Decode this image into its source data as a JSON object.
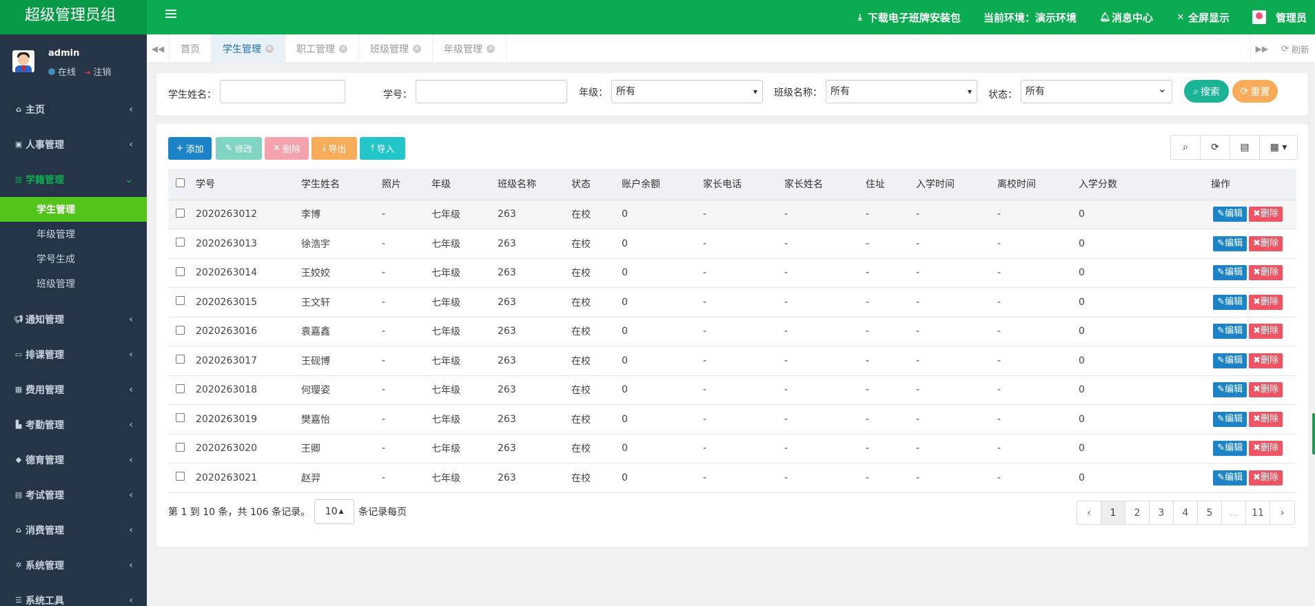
{
  "app": {
    "brand": "超级管理员组",
    "top_actions": [
      {
        "icon": "download-icon",
        "label": "下载电子班牌安装包"
      },
      {
        "icon": "env-icon",
        "label": "当前环境：演示环境"
      },
      {
        "icon": "bell-icon",
        "label": "消息中心"
      },
      {
        "icon": "fullscreen-icon",
        "label": "全屏显示"
      }
    ],
    "top_user": "管理员"
  },
  "sidebar": {
    "user": {
      "name": "admin",
      "status": "在线",
      "logout": "注销"
    },
    "menu": [
      {
        "icon": "home-icon",
        "label": "主页"
      },
      {
        "icon": "id-card-icon",
        "label": "人事管理"
      },
      {
        "icon": "bank-icon",
        "label": "学籍管理",
        "expanded": true,
        "children": [
          "学生管理",
          "年级管理",
          "学号生成",
          "班级管理"
        ]
      },
      {
        "icon": "bullhorn-icon",
        "label": "通知管理"
      },
      {
        "icon": "calendar-icon",
        "label": "排课管理"
      },
      {
        "icon": "calculator-icon",
        "label": "费用管理"
      },
      {
        "icon": "bar-chart-icon",
        "label": "考勤管理"
      },
      {
        "icon": "graduation-cap-icon",
        "label": "德育管理"
      },
      {
        "icon": "newspaper-icon",
        "label": "考试管理"
      },
      {
        "icon": "shop-icon",
        "label": "消费管理"
      },
      {
        "icon": "gear-icon",
        "label": "系统管理"
      },
      {
        "icon": "list-icon",
        "label": "系统工具"
      }
    ]
  },
  "tabs": {
    "items": [
      "首页",
      "学生管理",
      "职工管理",
      "班级管理",
      "年级管理"
    ],
    "active": 1,
    "refresh": "刷新"
  },
  "search": {
    "name_label": "学生姓名：",
    "name_value": "",
    "number_label": "学号：",
    "number_value": "",
    "grade_label": "年级：",
    "grade_value": "所有",
    "class_label": "班级名称：",
    "class_value": "所有",
    "status_label": "状态：",
    "status_value": "所有",
    "search_btn": "搜索",
    "reset_btn": "重置"
  },
  "toolbar": {
    "add": "添加",
    "edit": "修改",
    "delete": "删除",
    "export": "导出",
    "import": "导入"
  },
  "table": {
    "columns": [
      "学号",
      "学生姓名",
      "照片",
      "年级",
      "班级名称",
      "状态",
      "账户余额",
      "家长电话",
      "家长姓名",
      "住址",
      "入学时间",
      "离校时间",
      "入学分数",
      "操作"
    ],
    "rows": [
      [
        "2020263012",
        "李博",
        "-",
        "七年级",
        "263",
        "在校",
        "0",
        "-",
        "-",
        "-",
        "-",
        "-",
        "0"
      ],
      [
        "2020263013",
        "徐浩宇",
        "-",
        "七年级",
        "263",
        "在校",
        "0",
        "-",
        "-",
        "-",
        "-",
        "-",
        "0"
      ],
      [
        "2020263014",
        "王姣姣",
        "-",
        "七年级",
        "263",
        "在校",
        "0",
        "-",
        "-",
        "-",
        "-",
        "-",
        "0"
      ],
      [
        "2020263015",
        "王文轩",
        "-",
        "七年级",
        "263",
        "在校",
        "0",
        "-",
        "-",
        "-",
        "-",
        "-",
        "0"
      ],
      [
        "2020263016",
        "袁嘉鑫",
        "-",
        "七年级",
        "263",
        "在校",
        "0",
        "-",
        "-",
        "-",
        "-",
        "-",
        "0"
      ],
      [
        "2020263017",
        "王砚博",
        "-",
        "七年级",
        "263",
        "在校",
        "0",
        "-",
        "-",
        "-",
        "-",
        "-",
        "0"
      ],
      [
        "2020263018",
        "何璎姿",
        "-",
        "七年级",
        "263",
        "在校",
        "0",
        "-",
        "-",
        "-",
        "-",
        "-",
        "0"
      ],
      [
        "2020263019",
        "樊嘉怡",
        "-",
        "七年级",
        "263",
        "在校",
        "0",
        "-",
        "-",
        "-",
        "-",
        "-",
        "0"
      ],
      [
        "2020263020",
        "王卿",
        "-",
        "七年级",
        "263",
        "在校",
        "0",
        "-",
        "-",
        "-",
        "-",
        "-",
        "0"
      ],
      [
        "2020263021",
        "赵羿",
        "-",
        "七年级",
        "263",
        "在校",
        "0",
        "-",
        "-",
        "-",
        "-",
        "-",
        "0"
      ]
    ],
    "edit_label": "编辑",
    "delete_label": "删除"
  },
  "pager": {
    "info": "第 1 到 10 条，共 106 条记录。",
    "page_size": "10",
    "per_page": "条记录每页",
    "pages": [
      "‹",
      "1",
      "2",
      "3",
      "4",
      "5",
      "...",
      "11",
      "›"
    ],
    "current": "1"
  },
  "colors": {
    "topbar": "#0bab52",
    "sidebar": "#253446",
    "active_sub": "#52c41a",
    "primary": "#1c84c6",
    "danger": "#ed5565"
  }
}
